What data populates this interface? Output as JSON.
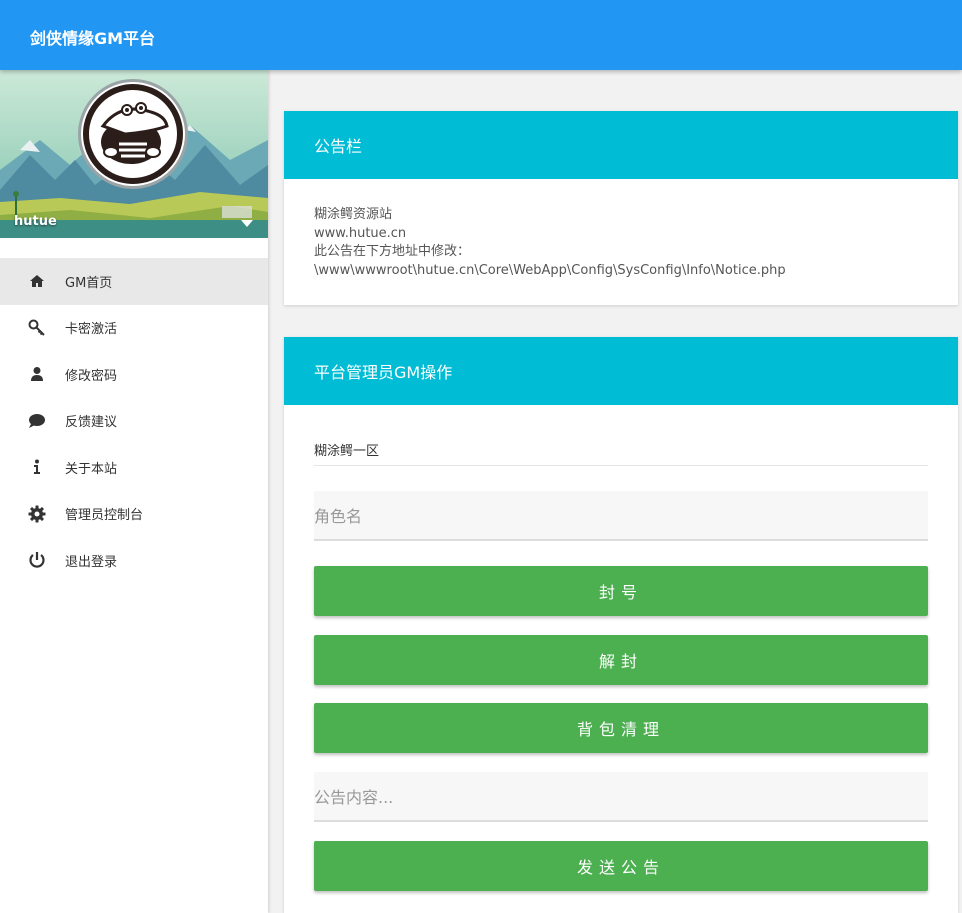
{
  "header": {
    "title": "剑侠情缘GM平台"
  },
  "profile": {
    "username": "hutue"
  },
  "sidebar": {
    "items": [
      {
        "label": "GM首页",
        "icon": "home-icon",
        "active": true
      },
      {
        "label": "卡密激活",
        "icon": "key-icon"
      },
      {
        "label": "修改密码",
        "icon": "user-icon"
      },
      {
        "label": "反馈建议",
        "icon": "comment-icon"
      },
      {
        "label": "关于本站",
        "icon": "info-icon"
      },
      {
        "label": "管理员控制台",
        "icon": "gear-icon"
      },
      {
        "label": "退出登录",
        "icon": "power-icon"
      }
    ]
  },
  "notice_card": {
    "title": "公告栏",
    "lines": [
      "糊涂鳄资源站",
      "www.hutue.cn",
      "此公告在下方地址中修改：",
      "\\www\\wwwroot\\hutue.cn\\Core\\WebApp\\Config\\SysConfig\\Info\\Notice.php"
    ]
  },
  "gm_card": {
    "title": "平台管理员GM操作",
    "server": "糊涂鳄一区",
    "role_placeholder": "角色名",
    "ban_label": "封号",
    "unban_label": "解封",
    "clear_bag_label": "背包清理",
    "announce_placeholder": "公告内容...",
    "send_label": "发送公告"
  },
  "colors": {
    "topbar": "#2196f3",
    "card_header": "#00bcd4",
    "button": "#4caf50"
  }
}
